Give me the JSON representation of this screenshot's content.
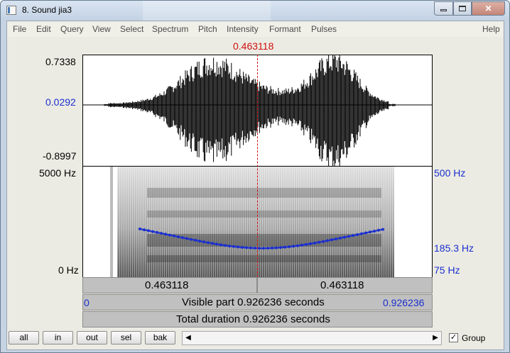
{
  "window": {
    "title": "8. Sound jia3"
  },
  "menu": [
    "File",
    "Edit",
    "Query",
    "View",
    "Select",
    "Spectrum",
    "Pitch",
    "Intensity",
    "Formant",
    "Pulses",
    "Help"
  ],
  "cursor": {
    "time_label": "0.463118"
  },
  "waveform": {
    "max_label": "0.7338",
    "zero_label": "0.0292",
    "min_label": "-0.8997"
  },
  "spectrogram": {
    "freq_top_label": "5000 Hz",
    "freq_bottom_label": "0 Hz"
  },
  "pitch": {
    "top_label": "500 Hz",
    "value_label": "185.3 Hz",
    "bottom_label": "75 Hz"
  },
  "time_bars": {
    "left_segment": "0.463118",
    "right_segment": "0.463118",
    "visible_start": "0",
    "visible_part": "Visible part 0.926236 seconds",
    "visible_end": "0.926236",
    "total_duration": "Total duration 0.926236 seconds"
  },
  "toolbar": {
    "all": "all",
    "in": "in",
    "out": "out",
    "sel": "sel",
    "bak": "bak",
    "group_label": "Group",
    "group_checked": "✓"
  },
  "icons": {
    "scroll_left": "scroll-left-arrow-icon",
    "scroll_right": "scroll-right-arrow-icon",
    "app": "praat-sound-window-icon"
  }
}
